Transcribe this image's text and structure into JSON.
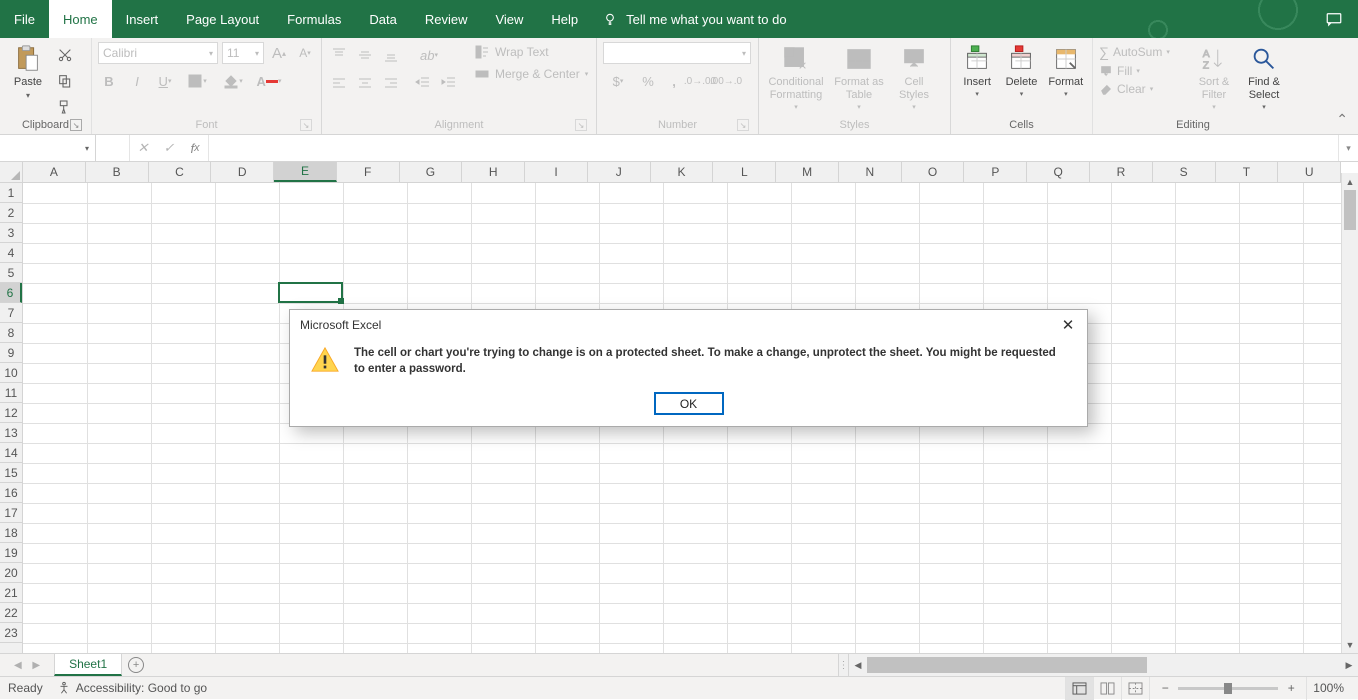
{
  "tabs": {
    "file": "File",
    "home": "Home",
    "insert": "Insert",
    "pageLayout": "Page Layout",
    "formulas": "Formulas",
    "data": "Data",
    "review": "Review",
    "view": "View",
    "help": "Help",
    "tellme": "Tell me what you want to do"
  },
  "ribbon": {
    "clipboard": {
      "paste": "Paste",
      "label": "Clipboard"
    },
    "font": {
      "name": "Calibri",
      "size": "11",
      "label": "Font"
    },
    "alignment": {
      "wrap": "Wrap Text",
      "merge": "Merge & Center",
      "label": "Alignment"
    },
    "number": {
      "label": "Number"
    },
    "styles": {
      "cond": "Conditional Formatting",
      "cond2": "",
      "table": "Format as Table",
      "cell": "Cell Styles",
      "label": "Styles"
    },
    "cells": {
      "insert": "Insert",
      "delete": "Delete",
      "format": "Format",
      "label": "Cells"
    },
    "editing": {
      "autosum": "AutoSum",
      "fill": "Fill",
      "clear": "Clear",
      "sort": "Sort & Filter",
      "find": "Find & Select",
      "label": "Editing"
    }
  },
  "formulaBar": {
    "nameBox": "",
    "formula": ""
  },
  "grid": {
    "cols": [
      "A",
      "B",
      "C",
      "D",
      "E",
      "F",
      "G",
      "H",
      "I",
      "J",
      "K",
      "L",
      "M",
      "N",
      "O",
      "P",
      "Q",
      "R",
      "S",
      "T",
      "U"
    ],
    "rows": [
      "1",
      "2",
      "3",
      "4",
      "5",
      "6",
      "7",
      "8",
      "9",
      "10",
      "11",
      "12",
      "13",
      "14",
      "15",
      "16",
      "17",
      "18",
      "19",
      "20",
      "21",
      "22",
      "23"
    ],
    "selectedCol": 4,
    "selectedRow": 5
  },
  "sheet": {
    "name": "Sheet1"
  },
  "status": {
    "ready": "Ready",
    "accessibility": "Accessibility: Good to go",
    "zoom": "100%"
  },
  "dialog": {
    "title": "Microsoft Excel",
    "message": "The cell or chart you're trying to change is on a protected sheet. To make a change, unprotect the sheet. You might be requested to enter a password.",
    "ok": "OK"
  }
}
